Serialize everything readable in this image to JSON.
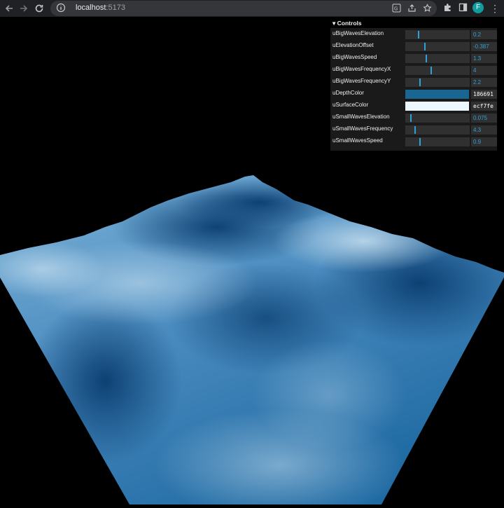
{
  "browser": {
    "url_host": "localhost",
    "url_port": ":5173",
    "avatar_letter": "F"
  },
  "gui": {
    "title": "Controls",
    "accent_color": "#2fa1d6",
    "controls": [
      {
        "label": "uBigWavesElevation",
        "type": "slider",
        "value": "0.2",
        "fraction": 0.2
      },
      {
        "label": "uElevationOffset",
        "type": "slider",
        "value": "-0.387",
        "fraction": 0.3
      },
      {
        "label": "uBigWavesSpeed",
        "type": "slider",
        "value": "1.3",
        "fraction": 0.32
      },
      {
        "label": "uBigWavesFrequencyX",
        "type": "slider",
        "value": "4",
        "fraction": 0.4
      },
      {
        "label": "uBigWavesFrequencyY",
        "type": "slider",
        "value": "2.2",
        "fraction": 0.22
      },
      {
        "label": "uDepthColor",
        "type": "color",
        "value": "186691",
        "color": "#186691"
      },
      {
        "label": "uSurfaceColor",
        "type": "color",
        "value": "ecf7fe",
        "color": "#ecf7fe"
      },
      {
        "label": "uSmallWavesElevation",
        "type": "slider",
        "value": "0.075",
        "fraction": 0.08
      },
      {
        "label": "uSmallWavesFrequency",
        "type": "slider",
        "value": "4.3",
        "fraction": 0.14
      },
      {
        "label": "uSmallWavesSpeed",
        "type": "slider",
        "value": "0.9",
        "fraction": 0.22
      }
    ]
  },
  "scene": {
    "depth_color": "#186691",
    "surface_color": "#ecf7fe"
  }
}
